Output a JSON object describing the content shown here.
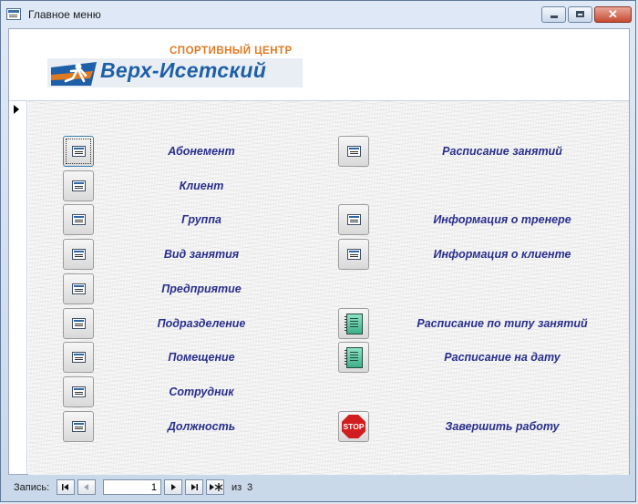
{
  "window": {
    "title": "Главное меню"
  },
  "header": {
    "logo_top": "СПОРТИВНЫЙ ЦЕНТР",
    "logo_main": "Верх-Исетский"
  },
  "menu_left": [
    {
      "label": "Абонемент",
      "icon": "form-icon",
      "focused": true
    },
    {
      "label": "Клиент",
      "icon": "form-icon"
    },
    {
      "label": "Группа",
      "icon": "form-icon"
    },
    {
      "label": "Вид занятия",
      "icon": "form-icon"
    },
    {
      "label": "Предприятие",
      "icon": "form-icon"
    },
    {
      "label": "Подразделение",
      "icon": "form-icon"
    },
    {
      "label": "Помещение",
      "icon": "form-icon"
    },
    {
      "label": "Сотрудник",
      "icon": "form-icon"
    },
    {
      "label": "Должность",
      "icon": "form-icon"
    }
  ],
  "menu_right": [
    {
      "label": "Расписание занятий",
      "icon": "form-icon"
    },
    {
      "label": "Информация о тренере",
      "icon": "form-icon"
    },
    {
      "label": "Информация о клиенте",
      "icon": "form-icon"
    },
    {
      "label": "Расписание по типу занятий",
      "icon": "report-icon"
    },
    {
      "label": "Расписание на дату",
      "icon": "report-icon"
    },
    {
      "label": "Завершить работу",
      "icon": "stop-icon",
      "stop_text": "STOP"
    }
  ],
  "navigation": {
    "label": "Запись:",
    "current": "1",
    "of": "из",
    "total": "3"
  },
  "colors": {
    "label": "#2a2f8c",
    "brand_orange": "#e07a22",
    "brand_blue": "#1e5fa8"
  }
}
